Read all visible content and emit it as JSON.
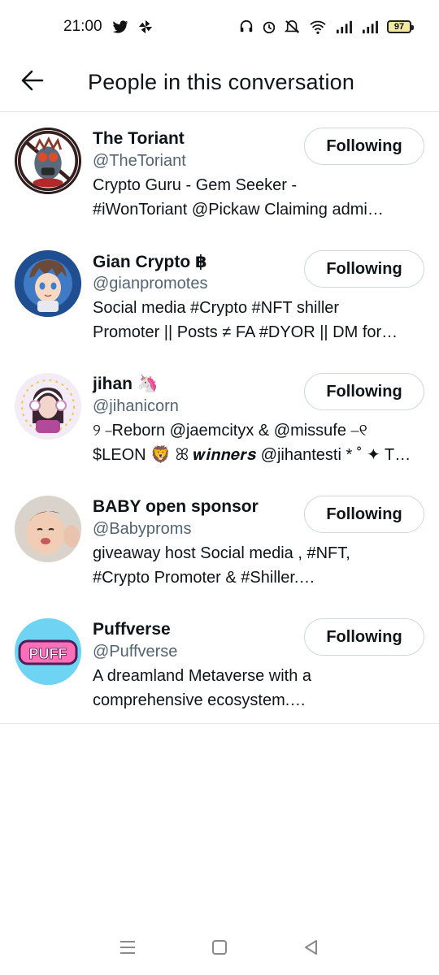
{
  "status_bar": {
    "time": "21:00",
    "battery": "97",
    "icons": [
      "twitter-icon",
      "pinwheel-icon",
      "headset-icon",
      "alarm-icon",
      "mute-icon",
      "wifi-icon",
      "signal-icon",
      "signal-icon-2",
      "battery-icon"
    ]
  },
  "header": {
    "title": "People in this conversation",
    "back_icon": "back-arrow-icon"
  },
  "users": [
    {
      "name": "The Toriant",
      "handle": "@TheToriant",
      "bio_line1": "Crypto Guru - Gem Seeker -",
      "bio_line2": "#iWonToriant @Pickaw  Claiming admi…",
      "button": "Following"
    },
    {
      "name": "Gian Crypto ฿",
      "handle": "@gianpromotes",
      "bio_line1": "Social media #Crypto #NFT shiller",
      "bio_line2": "Promoter || Posts ≠ FA #DYOR || DM for…",
      "button": "Following"
    },
    {
      "name": "jihan 🦄",
      "handle": "@jihanicorn",
      "bio_line1": "୨ ⎯Reborn @jaemcityx & @missufe ⎯୧",
      "bio_line2": "$LEON 🦁 ꕤ 𝒘𝒊𝒏𝒏𝒆𝒓𝒔 @jihantesti * ˚ ✦ T…",
      "button": "Following"
    },
    {
      "name": "BABY open sponsor",
      "handle": "@Babyproms",
      "bio_line1": "giveaway host Social media , #NFT,",
      "bio_line2": "#Crypto Promoter & #Shiller.…",
      "button": "Following"
    },
    {
      "name": "Puffverse",
      "handle": "@Puffverse",
      "bio_line1": "A dreamland Metaverse with a",
      "bio_line2": "comprehensive ecosystem.…",
      "button": "Following",
      "avatar_text": "PUFF"
    }
  ],
  "nav": {
    "icons": [
      "menu-icon",
      "home-square-icon",
      "back-triangle-icon"
    ]
  },
  "colors": {
    "text_primary": "#0f1419",
    "text_secondary": "#536471",
    "button_border": "#cfd9de",
    "divider": "#e6e9ec"
  }
}
